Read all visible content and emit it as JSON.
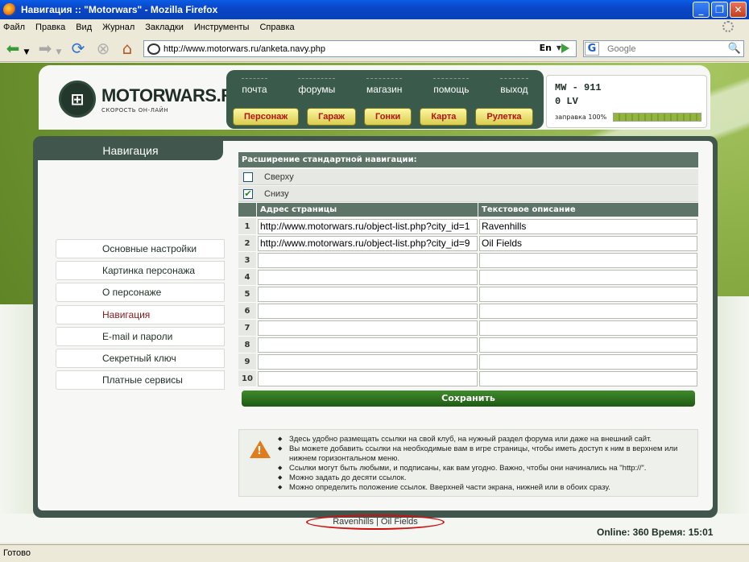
{
  "window": {
    "title": "Навигация :: \"Motorwars\" - Mozilla Firefox"
  },
  "menu": [
    "Файл",
    "Правка",
    "Вид",
    "Журнал",
    "Закладки",
    "Инструменты",
    "Справка"
  ],
  "toolbar": {
    "url": "http://www.motorwars.ru/anketa.navy.php",
    "lang": "En",
    "search_engine": "G",
    "search_placeholder": "Google"
  },
  "site": {
    "logo_name": "MOTORWARS.RU",
    "logo_tagline": "СКОРОСТЬ ОН-ЛАЙН",
    "top_links": [
      "почта",
      "форумы",
      "магазин",
      "помощь",
      "выход"
    ],
    "top_buttons": [
      "Персонаж",
      "Гараж",
      "Гонки",
      "Карта",
      "Рулетка"
    ],
    "player": "MW - 911",
    "balance": "0 LV",
    "fuel_label": "заправка 100%",
    "fuel_percent": 100
  },
  "sidebar": {
    "title": "Навигация",
    "items": [
      {
        "label": "Основные настройки",
        "active": false
      },
      {
        "label": "Картинка персонажа",
        "active": false
      },
      {
        "label": "О персонаже",
        "active": false
      },
      {
        "label": "Навигация",
        "active": true
      },
      {
        "label": "E-mail и пароли",
        "active": false
      },
      {
        "label": "Секретный ключ",
        "active": false
      },
      {
        "label": "Платные сервисы",
        "active": false
      }
    ]
  },
  "form": {
    "heading": "Расширение стандартной навигации:",
    "option_top": {
      "label": "Сверху",
      "checked": false
    },
    "option_bottom": {
      "label": "Снизу",
      "checked": true
    },
    "columns": [
      "Адрес страницы",
      "Текстовое описание"
    ],
    "rows": [
      {
        "n": "1",
        "url": "http://www.motorwars.ru/object-list.php?city_id=1",
        "text": "Ravenhills"
      },
      {
        "n": "2",
        "url": "http://www.motorwars.ru/object-list.php?city_id=9",
        "text": "Oil Fields"
      },
      {
        "n": "3",
        "url": "",
        "text": ""
      },
      {
        "n": "4",
        "url": "",
        "text": ""
      },
      {
        "n": "5",
        "url": "",
        "text": ""
      },
      {
        "n": "6",
        "url": "",
        "text": ""
      },
      {
        "n": "7",
        "url": "",
        "text": ""
      },
      {
        "n": "8",
        "url": "",
        "text": ""
      },
      {
        "n": "9",
        "url": "",
        "text": ""
      },
      {
        "n": "10",
        "url": "",
        "text": ""
      }
    ],
    "save_label": "Сохранить"
  },
  "info": [
    "Здесь удобно размещать ссылки на свой клуб, на нужный раздел форума или даже на внешний сайт.",
    "Вы можете добавить ссылки на необходимые вам в игре страницы, чтобы иметь доступ к ним в верхнем или нижнем горизонтальном меню.",
    "Ссылки могут быть любыми, и подписаны, как вам угодно. Важно, чтобы они начинались на \"http://\".",
    "Можно задать до десяти ссылок.",
    "Можно определить положение ссылок. Вверхней части экрана, нижней или в обоих сразу."
  ],
  "footer": {
    "nav_links": "Ravenhills | Oil Fields",
    "online": "Online: 360  Время: 15:01"
  },
  "status": "Готово"
}
